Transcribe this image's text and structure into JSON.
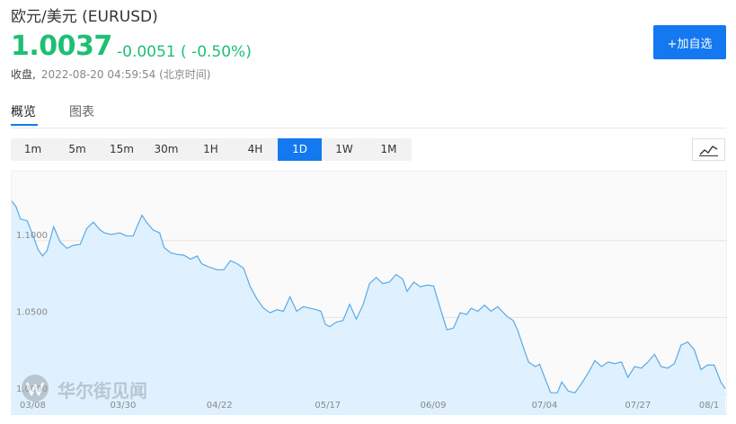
{
  "header": {
    "title": "欧元/美元 (EURUSD)",
    "price": "1.0037",
    "change": "-0.0051 ( -0.50%)",
    "status_label": "收盘,",
    "timestamp": "2022-08-20 04:59:54 (北京时间)",
    "add_watchlist_label": "+加自选"
  },
  "tabs": [
    {
      "label": "概览",
      "active": true
    },
    {
      "label": "图表",
      "active": false
    }
  ],
  "periods": [
    {
      "label": "1m"
    },
    {
      "label": "5m"
    },
    {
      "label": "15m"
    },
    {
      "label": "30m"
    },
    {
      "label": "1H"
    },
    {
      "label": "4H"
    },
    {
      "label": "1D",
      "active": true
    },
    {
      "label": "1W"
    },
    {
      "label": "1M"
    }
  ],
  "colors": {
    "up_down_green": "#1dbf73",
    "accent_blue": "#1478f0",
    "line": "#5aa9e6",
    "area": "#dcefff"
  },
  "icons": {
    "chart_type": "line-chart-icon",
    "watermark": "wallstreetcn-logo"
  },
  "watermark_text": "华尔街见闻",
  "chart_data": {
    "type": "area",
    "y_ticks": [
      {
        "value": 1.1,
        "label": "1.1000"
      },
      {
        "value": 1.05,
        "label": "1.0500"
      },
      {
        "value": 1.0,
        "label": "1.0000"
      }
    ],
    "ylim": [
      0.9865,
      1.1455
    ],
    "x_ticks": [
      {
        "index": 7,
        "label": "03/08"
      },
      {
        "index": 37,
        "label": "03/30"
      },
      {
        "index": 69,
        "label": "04/22"
      },
      {
        "index": 105,
        "label": "05/17"
      },
      {
        "index": 140,
        "label": "06/09"
      },
      {
        "index": 177,
        "label": "07/04"
      },
      {
        "index": 208,
        "label": "07/27"
      },
      {
        "index": 235,
        "label": "08/1"
      }
    ],
    "x_count": 237,
    "points": [
      [
        0,
        1.1258
      ],
      [
        2,
        1.122
      ],
      [
        4,
        1.114
      ],
      [
        7,
        1.113
      ],
      [
        10,
        1.102
      ],
      [
        12,
        1.094
      ],
      [
        14,
        1.09
      ],
      [
        16,
        1.0935
      ],
      [
        19,
        1.109
      ],
      [
        22,
        1.099
      ],
      [
        25,
        1.095
      ],
      [
        28,
        1.097
      ],
      [
        31,
        1.0975
      ],
      [
        34,
        1.108
      ],
      [
        37,
        1.112
      ],
      [
        40,
        1.107
      ],
      [
        42,
        1.105
      ],
      [
        45,
        1.104
      ],
      [
        49,
        1.105
      ],
      [
        52,
        1.103
      ],
      [
        55,
        1.103
      ],
      [
        57,
        1.11
      ],
      [
        59,
        1.1165
      ],
      [
        61,
        1.112
      ],
      [
        64,
        1.107
      ],
      [
        67,
        1.105
      ],
      [
        69,
        1.0955
      ],
      [
        72,
        1.092
      ],
      [
        75,
        1.091
      ],
      [
        78,
        1.0905
      ],
      [
        81,
        1.088
      ],
      [
        84,
        1.09
      ],
      [
        86,
        1.085
      ],
      [
        89,
        1.083
      ],
      [
        93,
        1.081
      ],
      [
        96,
        1.081
      ],
      [
        99,
        1.087
      ],
      [
        102,
        1.085
      ],
      [
        105,
        1.082
      ],
      [
        108,
        1.07
      ],
      [
        111,
        1.062
      ],
      [
        114,
        1.056
      ],
      [
        117,
        1.053
      ],
      [
        120,
        1.055
      ],
      [
        123,
        1.054
      ],
      [
        126,
        1.0635
      ],
      [
        129,
        1.054
      ],
      [
        132,
        1.057
      ],
      [
        135,
        1.056
      ],
      [
        138,
        1.055
      ],
      [
        140,
        1.054
      ],
      [
        142,
        1.0455
      ],
      [
        144,
        1.044
      ],
      [
        147,
        1.047
      ],
      [
        150,
        1.048
      ],
      [
        153,
        1.0585
      ],
      [
        156,
        1.049
      ],
      [
        159,
        1.058
      ],
      [
        162,
        1.072
      ],
      [
        165,
        1.076
      ],
      [
        168,
        1.072
      ],
      [
        171,
        1.073
      ],
      [
        174,
        1.078
      ],
      [
        177,
        1.075
      ],
      [
        179,
        1.067
      ],
      [
        182,
        1.073
      ],
      [
        185,
        1.07
      ],
      [
        188,
        1.071
      ],
      [
        191,
        1.0705
      ],
      [
        194,
        1.056
      ],
      [
        197,
        1.042
      ],
      [
        200,
        1.043
      ],
      [
        203,
        1.053
      ],
      [
        206,
        1.052
      ],
      [
        208,
        1.056
      ],
      [
        211,
        1.054
      ],
      [
        214,
        1.058
      ],
      [
        217,
        1.054
      ],
      [
        220,
        1.057
      ],
      [
        224,
        1.051
      ],
      [
        227,
        1.048
      ],
      [
        229,
        1.042
      ],
      [
        232,
        1.029
      ],
      [
        234,
        1.021
      ],
      [
        237,
        1.018
      ],
      [
        239,
        1.0195
      ],
      [
        241,
        1.012
      ],
      [
        244,
        1.001
      ],
      [
        247,
        1.001
      ],
      [
        249,
        1.008
      ],
      [
        252,
        1.002
      ],
      [
        255,
        1.001
      ],
      [
        258,
        1.007
      ],
      [
        261,
        1.014
      ],
      [
        264,
        1.022
      ],
      [
        267,
        1.018
      ],
      [
        270,
        1.021
      ],
      [
        273,
        1.02
      ],
      [
        276,
        1.021
      ],
      [
        279,
        1.011
      ],
      [
        282,
        1.018
      ],
      [
        285,
        1.017
      ],
      [
        288,
        1.021
      ],
      [
        291,
        1.026
      ],
      [
        294,
        1.018
      ],
      [
        297,
        1.017
      ],
      [
        300,
        1.02
      ],
      [
        303,
        1.032
      ],
      [
        306,
        1.034
      ],
      [
        309,
        1.029
      ],
      [
        312,
        1.016
      ],
      [
        315,
        1.019
      ],
      [
        318,
        1.019
      ],
      [
        321,
        1.008
      ],
      [
        323,
        1.0037
      ]
    ]
  }
}
